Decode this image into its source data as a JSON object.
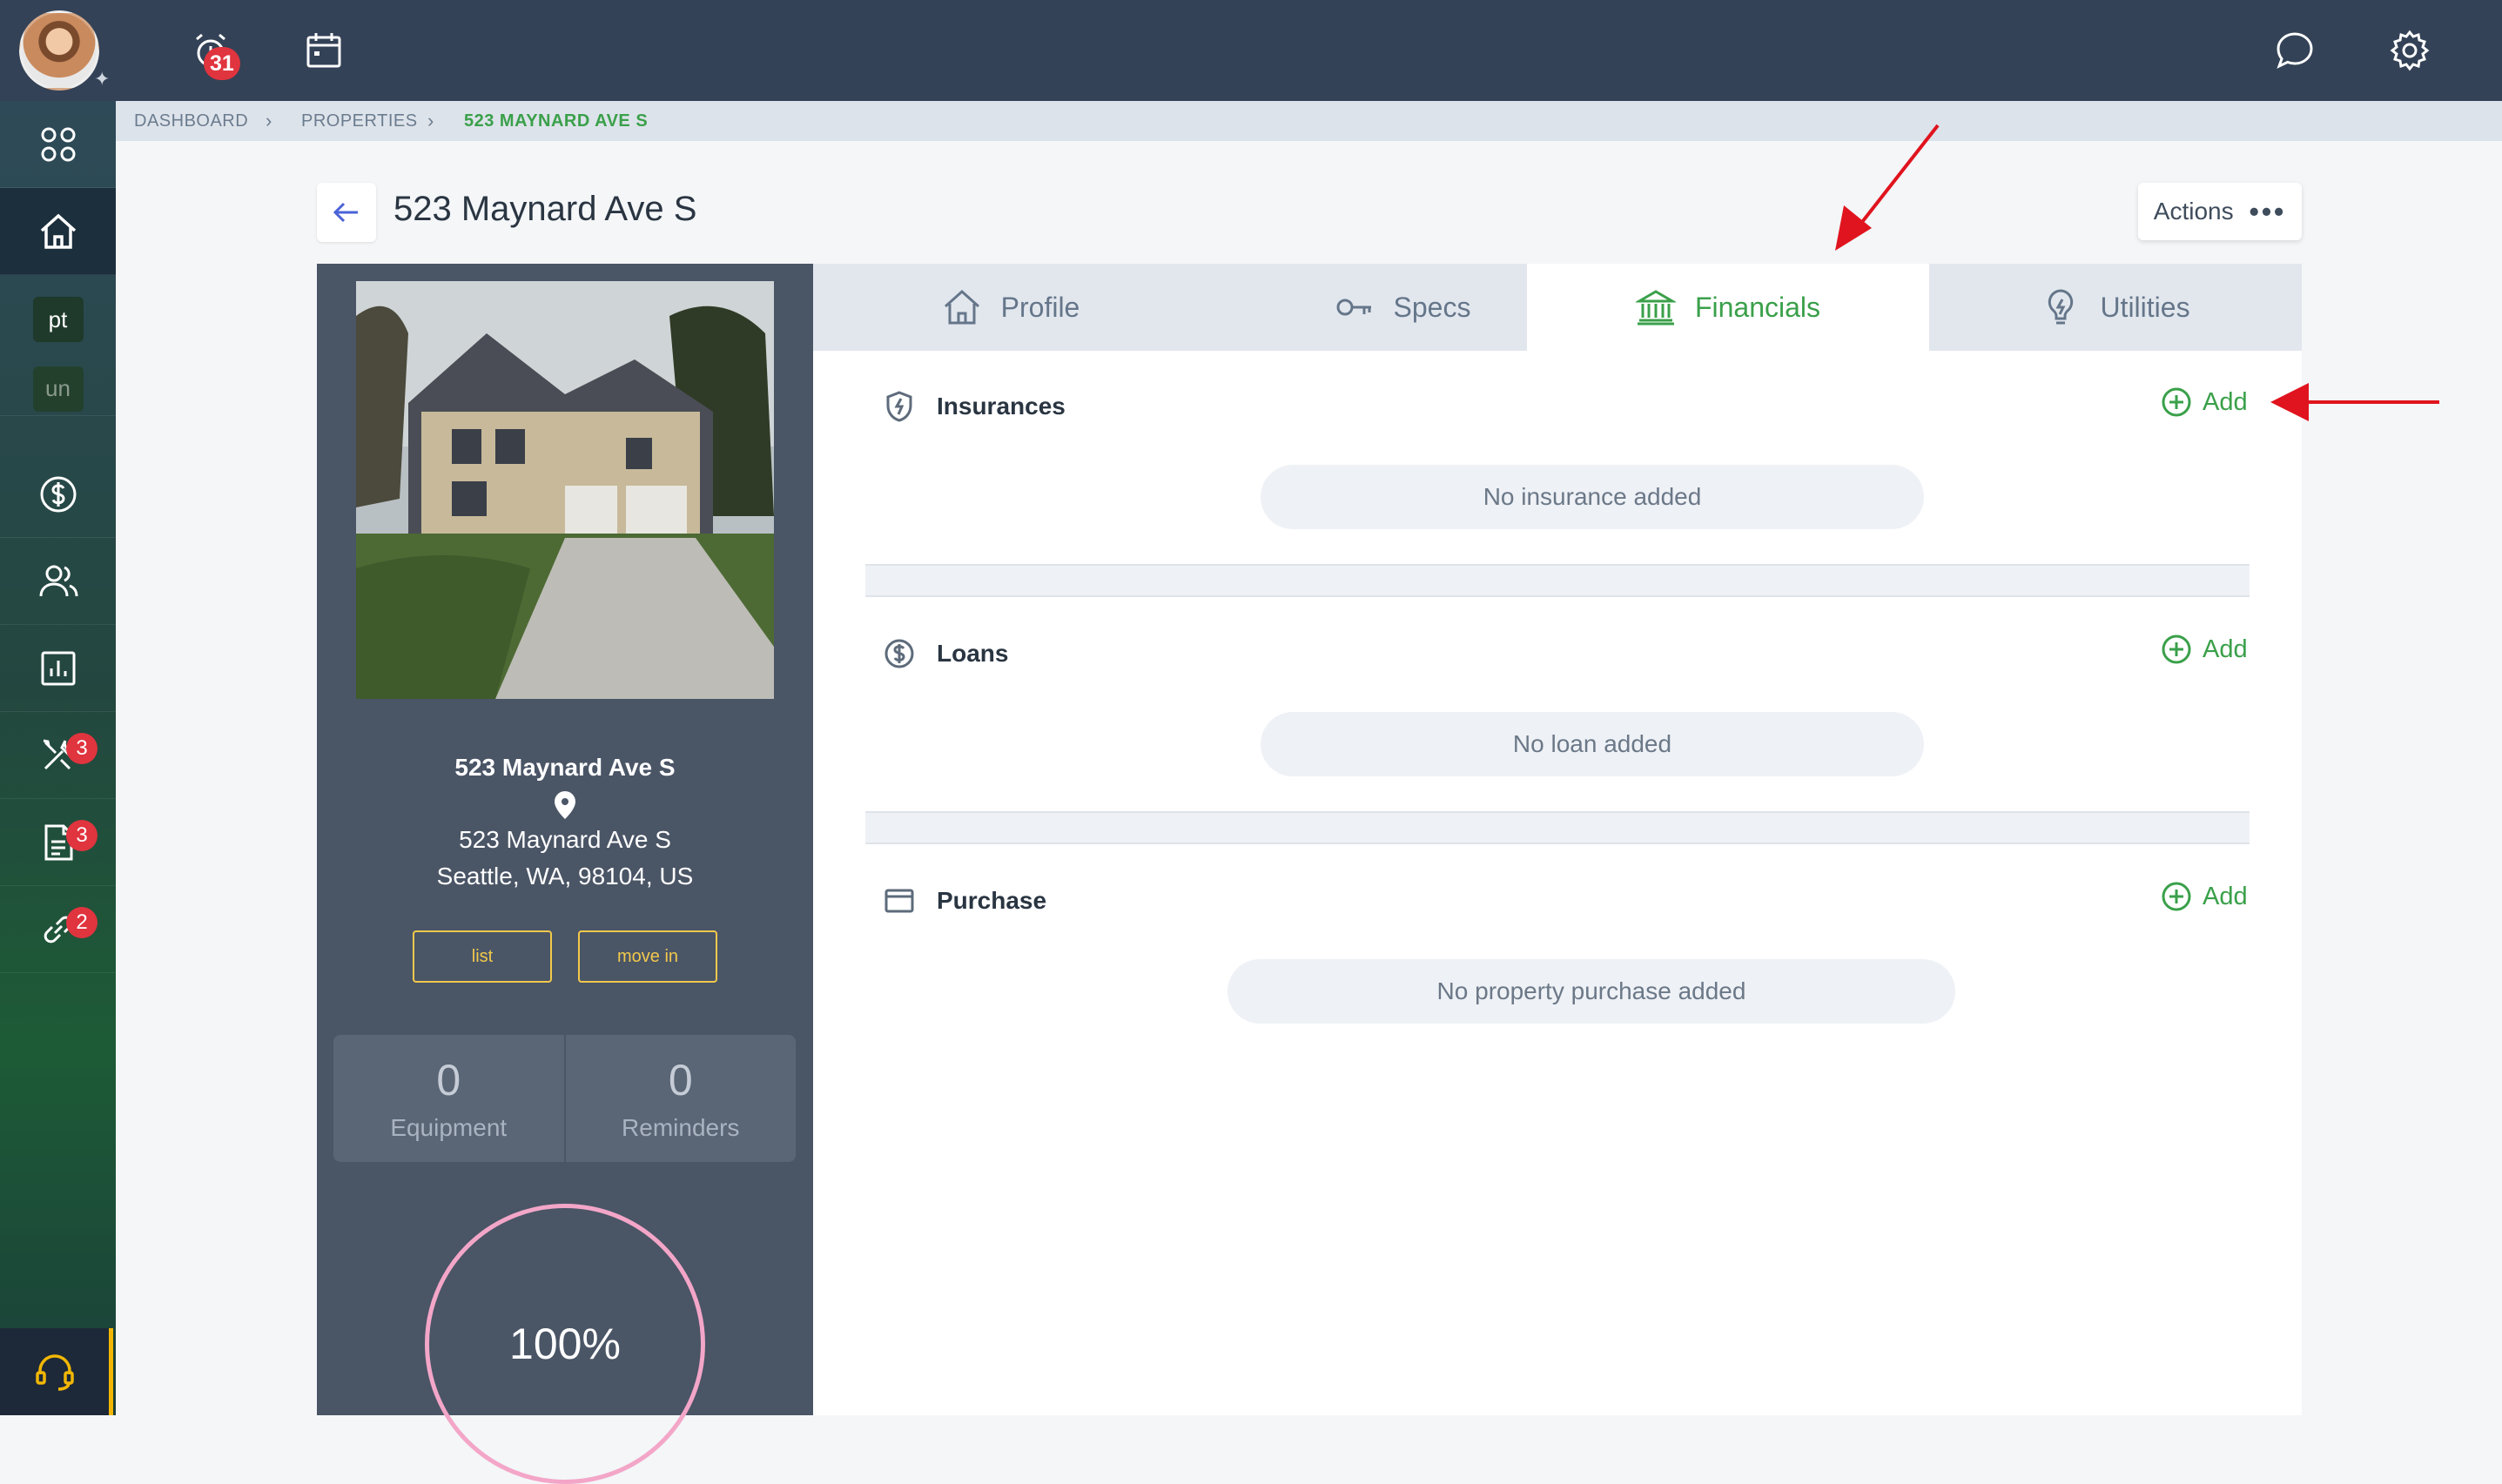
{
  "topbar": {
    "notifications_count": "31"
  },
  "sidebar": {
    "chip_pt": "pt",
    "chip_un": "un",
    "tools_badge": "3",
    "docs_badge": "3",
    "links_badge": "2"
  },
  "breadcrumb": {
    "dashboard": "DASHBOARD",
    "properties": "PROPERTIES",
    "current": "523 MAYNARD AVE S"
  },
  "header": {
    "title": "523 Maynard Ave S",
    "actions_label": "Actions",
    "actions_dots": "•••"
  },
  "property": {
    "name": "523 Maynard Ave S",
    "address_line1": "523 Maynard Ave S",
    "address_line2": "Seattle, WA, 98104, US",
    "btn_list": "list",
    "btn_move_in": "move in",
    "equipment_count": "0",
    "equipment_label": "Equipment",
    "reminders_count": "0",
    "reminders_label": "Reminders",
    "completion": "100%"
  },
  "tabs": [
    {
      "label": "Profile",
      "icon": "home-icon"
    },
    {
      "label": "Specs",
      "icon": "key-icon"
    },
    {
      "label": "Financials",
      "icon": "bank-icon",
      "active": true
    },
    {
      "label": "Utilities",
      "icon": "lightbulb-icon"
    }
  ],
  "financials": {
    "insurances": {
      "title": "Insurances",
      "add_label": "Add",
      "empty": "No insurance added"
    },
    "loans": {
      "title": "Loans",
      "add_label": "Add",
      "empty": "No loan added"
    },
    "purchase": {
      "title": "Purchase",
      "add_label": "Add",
      "empty": "No property purchase added"
    }
  },
  "colors": {
    "topbar": "#334257",
    "accent_green": "#3aa04a",
    "badge_red": "#e0343e",
    "panel": "#4a5566",
    "button_yellow": "#f2c94c",
    "ring_pink": "#f3a6c8",
    "annotation_red": "#e0141e"
  }
}
